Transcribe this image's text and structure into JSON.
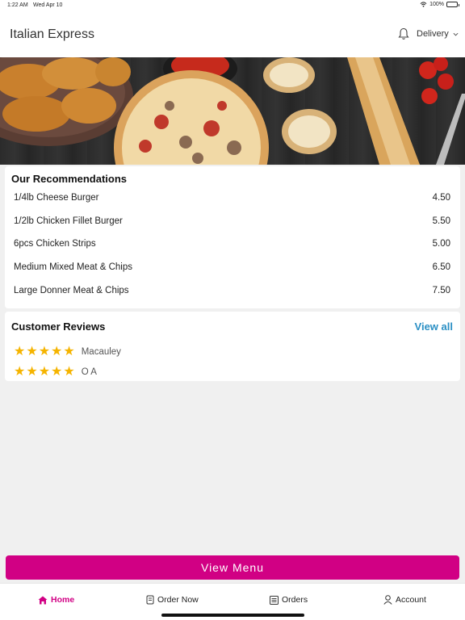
{
  "status_bar": {
    "time": "1:22 AM",
    "date": "Wed Apr 10",
    "battery": "100%"
  },
  "header": {
    "title": "Italian Express",
    "mode": "Delivery"
  },
  "recommendations": {
    "title": "Our Recommendations",
    "items": [
      {
        "name": "1/4lb Cheese Burger",
        "price": "4.50"
      },
      {
        "name": "1/2lb Chicken Fillet Burger",
        "price": "5.50"
      },
      {
        "name": "6pcs Chicken Strips",
        "price": "5.00"
      },
      {
        "name": "Medium Mixed Meat & Chips",
        "price": "6.50"
      },
      {
        "name": "Large Donner Meat & Chips",
        "price": "7.50"
      }
    ]
  },
  "reviews": {
    "title": "Customer Reviews",
    "view_all": "View all",
    "items": [
      {
        "name": "Macauley",
        "stars": 5
      },
      {
        "name": "O A",
        "stars": 5
      }
    ]
  },
  "view_menu_label": "View Menu",
  "tabs": [
    {
      "label": "Home",
      "icon": "home-icon",
      "active": true
    },
    {
      "label": "Order Now",
      "icon": "order-icon",
      "active": false
    },
    {
      "label": "Orders",
      "icon": "orders-icon",
      "active": false
    },
    {
      "label": "Account",
      "icon": "account-icon",
      "active": false
    }
  ],
  "colors": {
    "accent": "#d10084",
    "link": "#2a8fc4",
    "star": "#f5b400"
  }
}
